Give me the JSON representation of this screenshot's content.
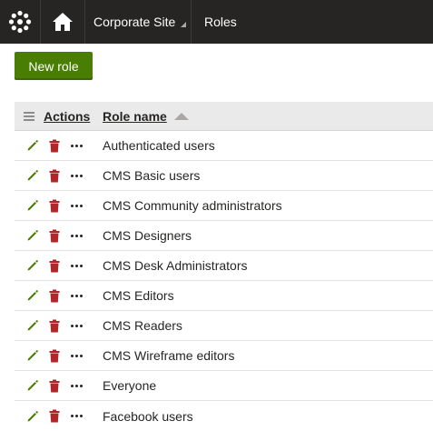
{
  "header": {
    "logo_icon": "kentico-logo-icon",
    "home_icon": "home-icon",
    "site_label": "Corporate Site",
    "app_label": "Roles"
  },
  "toolbar": {
    "new_role_label": "New role"
  },
  "grid": {
    "columns": {
      "actions": "Actions",
      "role_name": "Role name"
    },
    "sort": "ascending",
    "rows": [
      {
        "name": "Authenticated users"
      },
      {
        "name": "CMS Basic users"
      },
      {
        "name": "CMS Community administrators"
      },
      {
        "name": "CMS Designers"
      },
      {
        "name": "CMS Desk Administrators"
      },
      {
        "name": "CMS Editors"
      },
      {
        "name": "CMS Readers"
      },
      {
        "name": "CMS Wireframe editors"
      },
      {
        "name": "Everyone"
      },
      {
        "name": "Facebook users"
      }
    ]
  },
  "colors": {
    "topbar": "#262524",
    "primary_button": "#497d04",
    "edit_icon": "#497d04",
    "delete_icon": "#b12628"
  }
}
